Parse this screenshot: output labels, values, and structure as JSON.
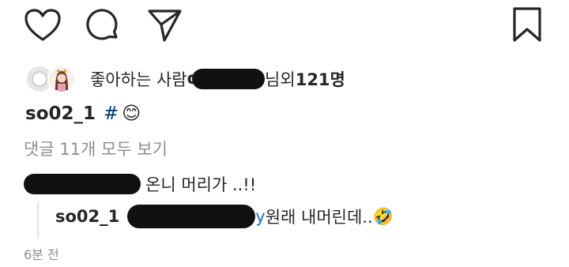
{
  "actions": {
    "like_icon": "heart-icon",
    "comment_icon": "comment-bubble-icon",
    "share_icon": "paper-plane-icon",
    "save_icon": "bookmark-icon"
  },
  "likes": {
    "prefix": "좋아하는 사람 ",
    "username_visible": "o",
    "suffix_nim": "님",
    "suffix_others": " 외 ",
    "count": "121명"
  },
  "caption": {
    "username": "so02_1",
    "hashtag": "#",
    "emoji": "😊"
  },
  "view_all_comments": "댓글 11개 모두 보기",
  "comment": {
    "text": "온니 머리가 ..!!"
  },
  "reply": {
    "username": "so02_1",
    "mention_tail": "y",
    "text": " 원래 내머린데..",
    "emoji": "🤣"
  },
  "timestamp": "6분 전"
}
